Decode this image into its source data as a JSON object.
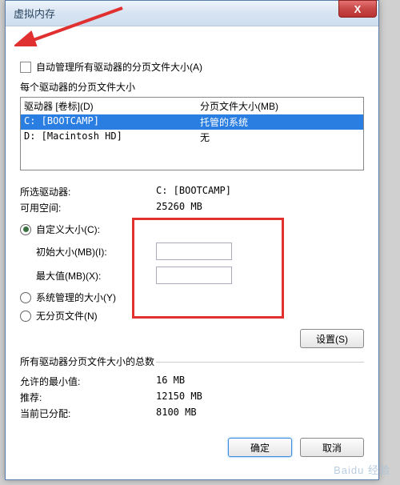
{
  "window": {
    "title": "虚拟内存",
    "close_icon": "X"
  },
  "auto_manage": {
    "label": "自动管理所有驱动器的分页文件大小(A)",
    "checked": false
  },
  "drive_section": {
    "label": "每个驱动器的分页文件大小",
    "header_drive": "驱动器 [卷标](D)",
    "header_paging": "分页文件大小(MB)",
    "rows": [
      {
        "drive": "C:   [BOOTCAMP]",
        "paging": "托管的系统",
        "selected": true
      },
      {
        "drive": "D:   [Macintosh HD]",
        "paging": "无",
        "selected": false
      }
    ]
  },
  "selected_info": {
    "drive_label": "所选驱动器:",
    "drive_value": "C: [BOOTCAMP]",
    "space_label": "可用空间:",
    "space_value": "25260 MB"
  },
  "size_options": {
    "custom_label": "自定义大小(C):",
    "initial_label": "初始大小(MB)(I):",
    "initial_value": "",
    "max_label": "最大值(MB)(X):",
    "max_value": "",
    "system_label": "系统管理的大小(Y)",
    "none_label": "无分页文件(N)",
    "selected": "custom"
  },
  "buttons": {
    "set": "设置(S)",
    "ok": "确定",
    "cancel": "取消"
  },
  "totals": {
    "title": "所有驱动器分页文件大小的总数",
    "min_label": "允许的最小值:",
    "min_value": "16 MB",
    "rec_label": "推荐:",
    "rec_value": "12150 MB",
    "cur_label": "当前已分配:",
    "cur_value": "8100 MB"
  },
  "watermark": "Baidu 经验"
}
